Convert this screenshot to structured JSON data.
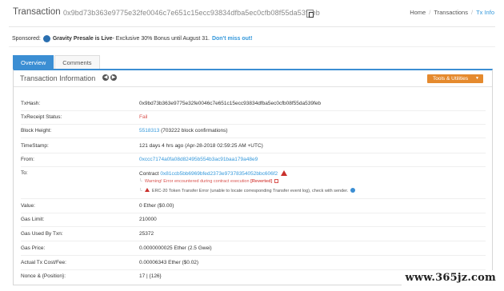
{
  "header": {
    "title": "Transaction",
    "tx_hash": "0x9bd73b363e9775e32fe0046c7e651c15ecc93834dfba5ec0cfb08f55da539feb",
    "breadcrumb": [
      "Home",
      "Transactions",
      "Tx Info"
    ]
  },
  "sponsored": {
    "label": "Sponsored:",
    "brand": "Gravity Presale is Live",
    "text": " - Exclusive 30% Bonus until August 31. ",
    "cta": "Don't miss out!"
  },
  "tabs": [
    "Overview",
    "Comments"
  ],
  "panel": {
    "title": "Transaction Information",
    "tools_label": "Tools & Utilities"
  },
  "rows": {
    "txhash": {
      "label": "TxHash:",
      "value": "0x9bd73b363e9775e32fe0046c7e651c15ecc93834dfba5ec0cfb08f55da539feb"
    },
    "receipt": {
      "label": "TxReceipt Status:",
      "value": "Fail"
    },
    "block": {
      "label": "Block Height:",
      "value": "5518313",
      "confirmations": " (703222 block confirmations)"
    },
    "timestamp": {
      "label": "TimeStamp:",
      "value": "121 days 4 hrs ago (Apr-28-2018 02:59:25 AM +UTC)"
    },
    "from": {
      "label": "From:",
      "value": "0xccc7174a0fa08d82495b554b3ac91baa179a48e9"
    },
    "to": {
      "label": "To:",
      "prefix": "Contract ",
      "value": "0x81ccb5bb6969bfed2373e97378354052bbc606f2",
      "warning_prefix": "Warning! Error encountered during contract execution ",
      "warning_bold": "[Reverted]",
      "erc20_error": "ERC-20 Token Transfer Error (unable to locate corresponding Transfer event log), check with sender."
    },
    "value": {
      "label": "Value:",
      "value": "0 Ether ($0.00)"
    },
    "gas_limit": {
      "label": "Gas Limit:",
      "value": "210000"
    },
    "gas_used": {
      "label": "Gas Used By Txn:",
      "value": "25372"
    },
    "gas_price": {
      "label": "Gas Price:",
      "value": "0.0000000025 Ether (2.5 Gwei)"
    },
    "cost": {
      "label": "Actual Tx Cost/Fee:",
      "value": "0.00006343 Ether ($0.02)"
    },
    "nonce": {
      "label": "Nonce & {Position}:",
      "value": "17 | {126}"
    }
  },
  "watermark": "www.365jz.com",
  "colors": {
    "accent": "#3b8ed3",
    "link": "#3498db",
    "fail": "#d9534f",
    "tools": "#e58a2e"
  }
}
